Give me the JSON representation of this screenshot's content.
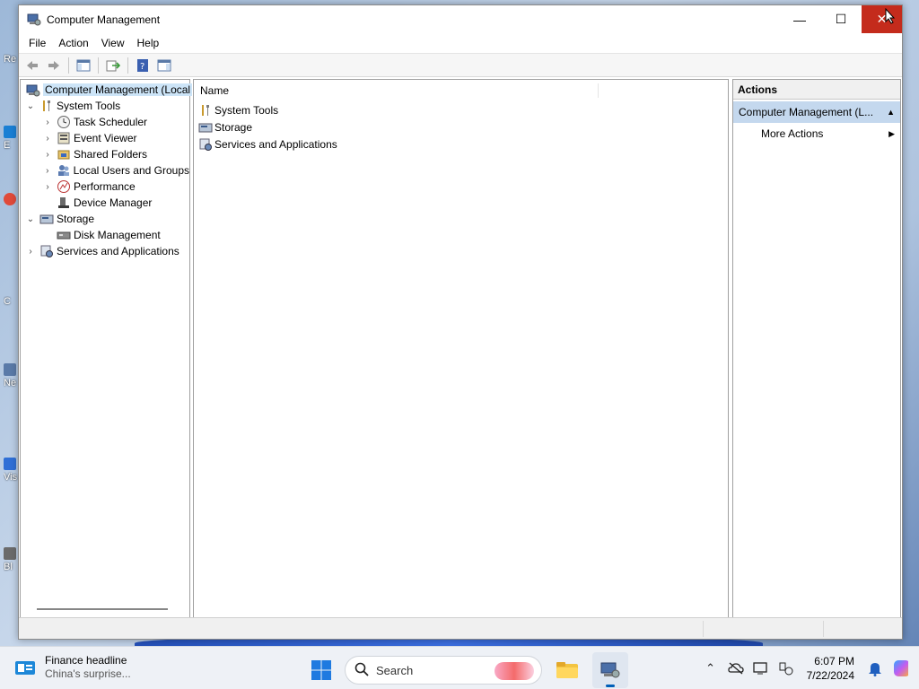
{
  "window": {
    "title": "Computer Management",
    "controls": {
      "minimize": "—",
      "maximize": "☐",
      "close": "✕"
    }
  },
  "menu": [
    "File",
    "Action",
    "View",
    "Help"
  ],
  "tree": {
    "items": [
      {
        "label": "Computer Management (Local",
        "level": 0,
        "chevron": "",
        "icon": "computer-management-icon",
        "selected": true
      },
      {
        "label": "System Tools",
        "level": 1,
        "chevron": "⌄",
        "icon": "tools-icon"
      },
      {
        "label": "Task Scheduler",
        "level": 2,
        "chevron": "›",
        "icon": "clock-icon"
      },
      {
        "label": "Event Viewer",
        "level": 2,
        "chevron": "›",
        "icon": "event-viewer-icon"
      },
      {
        "label": "Shared Folders",
        "level": 2,
        "chevron": "›",
        "icon": "shared-folders-icon"
      },
      {
        "label": "Local Users and Groups",
        "level": 2,
        "chevron": "›",
        "icon": "users-icon"
      },
      {
        "label": "Performance",
        "level": 2,
        "chevron": "›",
        "icon": "performance-icon"
      },
      {
        "label": "Device Manager",
        "level": 2,
        "chevron": "",
        "icon": "device-manager-icon"
      },
      {
        "label": "Storage",
        "level": 1,
        "chevron": "⌄",
        "icon": "storage-icon"
      },
      {
        "label": "Disk Management",
        "level": 2,
        "chevron": "",
        "icon": "disk-icon"
      },
      {
        "label": "Services and Applications",
        "level": 1,
        "chevron": "›",
        "icon": "services-icon"
      }
    ]
  },
  "content": {
    "column": "Name",
    "rows": [
      {
        "label": "System Tools",
        "icon": "tools-icon"
      },
      {
        "label": "Storage",
        "icon": "storage-icon"
      },
      {
        "label": "Services and Applications",
        "icon": "services-icon"
      }
    ]
  },
  "actions": {
    "header": "Actions",
    "section": "Computer Management (L...",
    "items": [
      {
        "label": "More Actions"
      }
    ]
  },
  "taskbar": {
    "news_title": "Finance headline",
    "news_sub": "China's surprise...",
    "search_placeholder": "Search",
    "time": "6:07 PM",
    "date": "7/22/2024"
  },
  "desktop": [
    "Re",
    "E",
    "",
    "C",
    "Ne",
    "Vis",
    "Bl"
  ],
  "colors": {
    "accent": "#005fb8",
    "close": "#c42b1c",
    "selection": "#cce4f7",
    "action_section": "#c4d8ee"
  }
}
